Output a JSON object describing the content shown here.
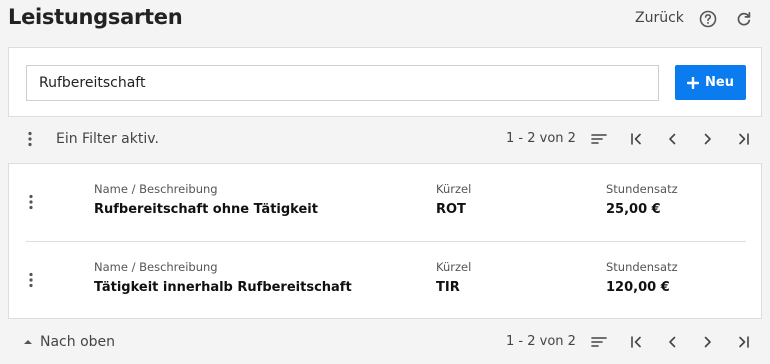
{
  "header": {
    "title": "Leistungsarten",
    "back_label": "Zurück",
    "help_icon": "help-circle-icon",
    "refresh_icon": "refresh-icon"
  },
  "search": {
    "value": "Rufbereitschaft",
    "new_button_label": "Neu"
  },
  "top_toolbar": {
    "filter_label": "Ein Filter aktiv.",
    "page_info": "1 - 2 von 2"
  },
  "list": {
    "columns": {
      "name": "Name / Beschreibung",
      "short": "Kürzel",
      "rate": "Stundensatz"
    },
    "rows": [
      {
        "name": "Rufbereitschaft ohne Tätigkeit",
        "short": "ROT",
        "rate": "25,00 €"
      },
      {
        "name": "Tätigkeit innerhalb Rufbereitschaft",
        "short": "TIR",
        "rate": "120,00 €"
      }
    ]
  },
  "bottom_toolbar": {
    "top_label": "Nach oben",
    "page_info": "1 - 2 von 2"
  },
  "colors": {
    "accent": "#0a7cf0",
    "background": "#f4f4f4",
    "panel": "#ffffff"
  }
}
